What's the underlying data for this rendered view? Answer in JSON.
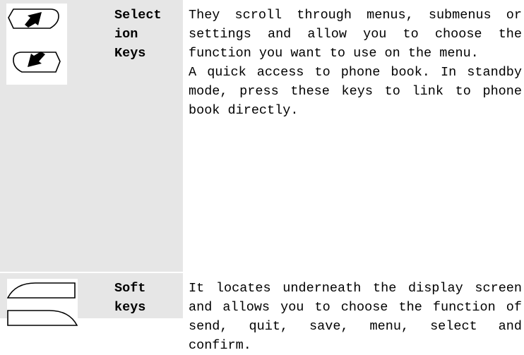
{
  "rows": [
    {
      "term_lines": [
        "Select",
        "ion",
        "Keys"
      ],
      "icons": [
        "selection-key-up-icon",
        "selection-key-down-icon"
      ],
      "description": [
        "They scroll through menus, submenus or settings and allow you to choose the function you want to use on the menu.",
        "A quick access to phone book. In standby mode, press these keys to link to phone book directly."
      ]
    },
    {
      "term_lines": [
        "Soft",
        "keys"
      ],
      "icons": [
        "soft-key-left-icon",
        "soft-key-right-icon"
      ],
      "description": [
        "It locates underneath the display screen and allows you to choose the function of send, quit, save, menu, select and confirm."
      ]
    }
  ],
  "colors": {
    "shaded_cell": "#e6e6e6",
    "text": "#000000"
  }
}
